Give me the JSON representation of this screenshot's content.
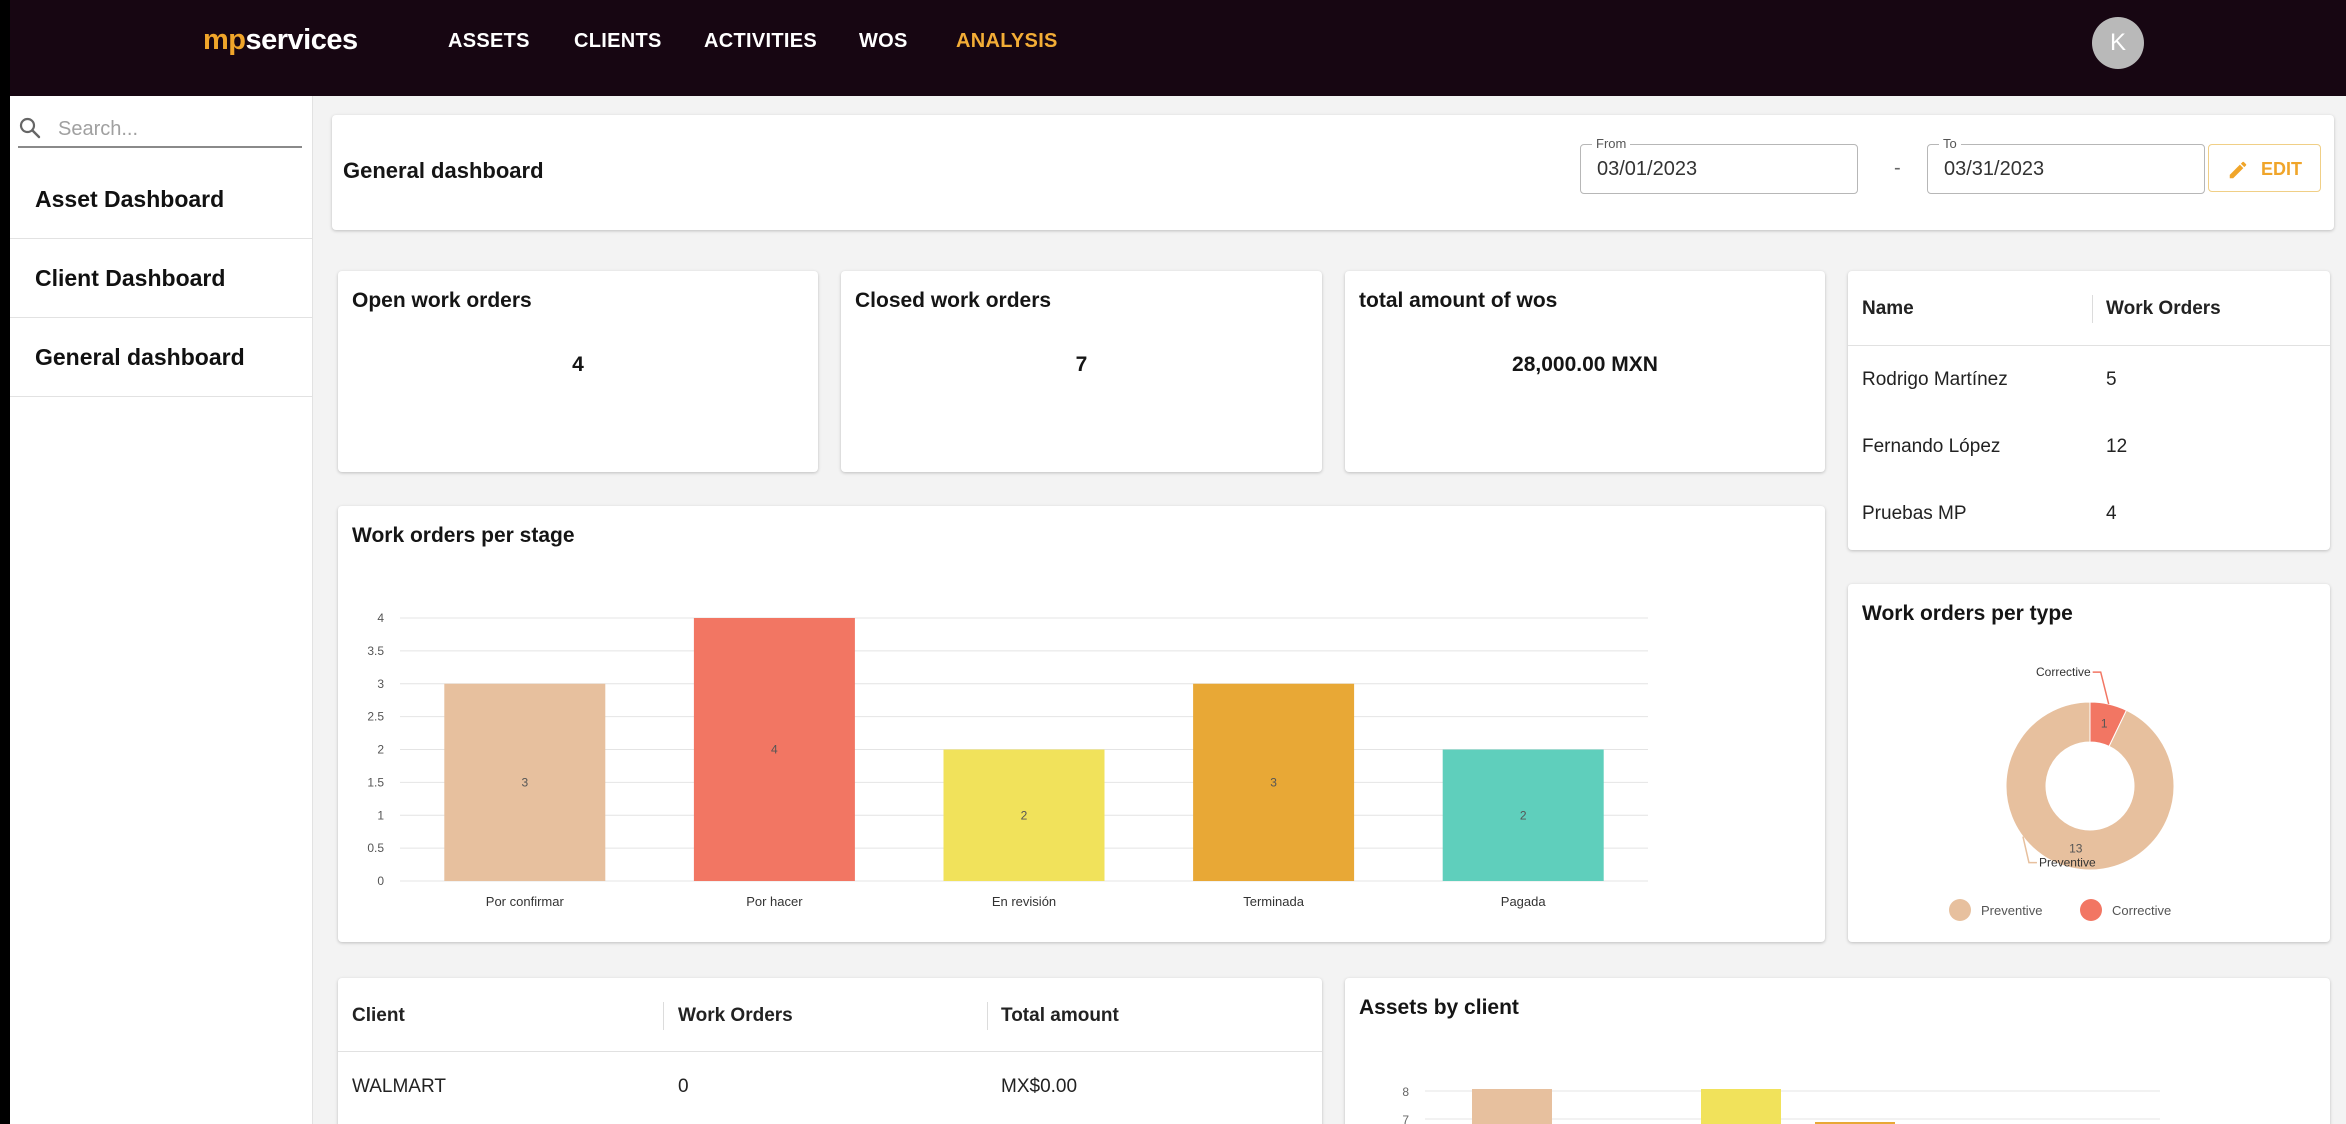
{
  "brand": {
    "part1": "mp",
    "part2": "services"
  },
  "nav": [
    {
      "label": "ASSETS",
      "active": false
    },
    {
      "label": "CLIENTS",
      "active": false
    },
    {
      "label": "ACTIVITIES",
      "active": false
    },
    {
      "label": "WOS",
      "active": false
    },
    {
      "label": "ANALYSIS",
      "active": true
    }
  ],
  "user": {
    "initial": "K"
  },
  "sidebar": {
    "search_placeholder": "Search...",
    "items": [
      {
        "label": "Asset Dashboard"
      },
      {
        "label": "Client Dashboard"
      },
      {
        "label": "General dashboard"
      }
    ]
  },
  "header": {
    "title": "General dashboard",
    "from_label": "From",
    "from_value": "03/01/2023",
    "separator": "-",
    "to_label": "To",
    "to_value": "03/31/2023",
    "edit_label": "EDIT"
  },
  "kpis": [
    {
      "title": "Open work orders",
      "value": "4"
    },
    {
      "title": "Closed work orders",
      "value": "7"
    },
    {
      "title": "total amount of wos",
      "value": "28,000.00 MXN"
    }
  ],
  "employees_table": {
    "columns": [
      "Name",
      "Work Orders"
    ],
    "rows": [
      [
        "Rodrigo Martínez",
        "5"
      ],
      [
        "Fernando López",
        "12"
      ],
      [
        "Pruebas MP",
        "4"
      ]
    ]
  },
  "clients_table": {
    "columns": [
      "Client",
      "Work Orders",
      "Total amount"
    ],
    "rows": [
      [
        "WALMART",
        "0",
        "MX$0.00"
      ]
    ]
  },
  "colors": {
    "accent": "#f0a52a",
    "topbar": "#170612",
    "bar_colors": [
      "#e7c09e",
      "#f27663",
      "#f1e25b",
      "#e8a836",
      "#5fcfbc"
    ]
  },
  "chart_data": [
    {
      "type": "bar",
      "title": "Work orders per stage",
      "categories": [
        "Por confirmar",
        "Por hacer",
        "En revisión",
        "Terminada",
        "Pagada"
      ],
      "values": [
        3,
        4,
        2,
        3,
        2
      ],
      "ylim": [
        0,
        4
      ],
      "yticks": [
        "0",
        "0.5",
        "1",
        "1.5",
        "2",
        "2.5",
        "3",
        "3.5",
        "4"
      ],
      "grid": true
    },
    {
      "type": "pie",
      "title": "Work orders per type",
      "labels": [
        "Preventive",
        "Corrective"
      ],
      "values": [
        13,
        1
      ],
      "colors": [
        "#e7c09e",
        "#f27663"
      ],
      "donut": true,
      "legend": "bottom"
    },
    {
      "type": "bar",
      "title": "Assets by client",
      "yticks": [
        "7",
        "8"
      ],
      "partial": true
    }
  ]
}
